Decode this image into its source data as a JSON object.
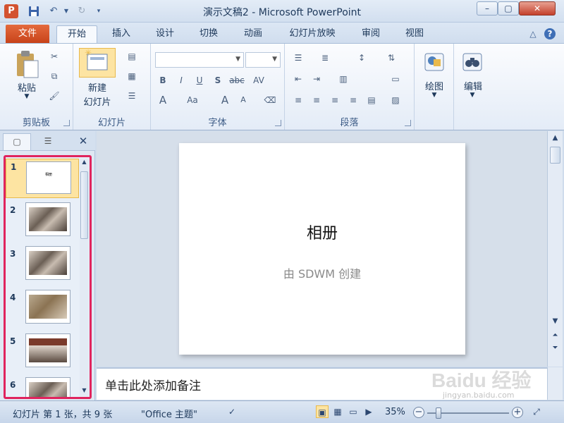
{
  "window": {
    "title": "演示文稿2 - Microsoft PowerPoint",
    "app_icon": "P"
  },
  "quick_access": [
    "save-icon",
    "undo-icon",
    "redo-icon",
    "customize-icon"
  ],
  "tabs": {
    "file": "文件",
    "items": [
      "开始",
      "插入",
      "设计",
      "切换",
      "动画",
      "幻灯片放映",
      "审阅",
      "视图"
    ],
    "active": "开始"
  },
  "ribbon": {
    "clipboard": {
      "paste": "粘贴",
      "label": "剪贴板"
    },
    "slides": {
      "new_slide_line1": "新建",
      "new_slide_line2": "幻灯片",
      "label": "幻灯片"
    },
    "font": {
      "label": "字体",
      "bold": "B",
      "italic": "I",
      "underline": "U",
      "shadow": "S",
      "strike": "abc",
      "spacing": "AV",
      "font_color": "A",
      "case": "Aa",
      "grow": "A",
      "shrink": "A"
    },
    "paragraph": {
      "label": "段落"
    },
    "drawing": {
      "label": "绘图"
    },
    "editing": {
      "label": "编辑"
    }
  },
  "left_panel": {
    "tabs": [
      "slides-tab",
      "outline-tab"
    ],
    "thumbnails": [
      {
        "num": "1",
        "selected": true,
        "title": "相册"
      },
      {
        "num": "2",
        "selected": false
      },
      {
        "num": "3",
        "selected": false
      },
      {
        "num": "4",
        "selected": false
      },
      {
        "num": "5",
        "selected": false
      },
      {
        "num": "6",
        "selected": false
      }
    ]
  },
  "slide": {
    "title": "相册",
    "subtitle": "由 SDWM 创建"
  },
  "notes": {
    "placeholder": "单击此处添加备注"
  },
  "statusbar": {
    "slide_info": "幻灯片 第 1 张，共 9 张",
    "theme": "\"Office 主题\"",
    "zoom": "35%"
  },
  "watermark": {
    "logo": "Baidu 经验",
    "url": "jingyan.baidu.com"
  }
}
